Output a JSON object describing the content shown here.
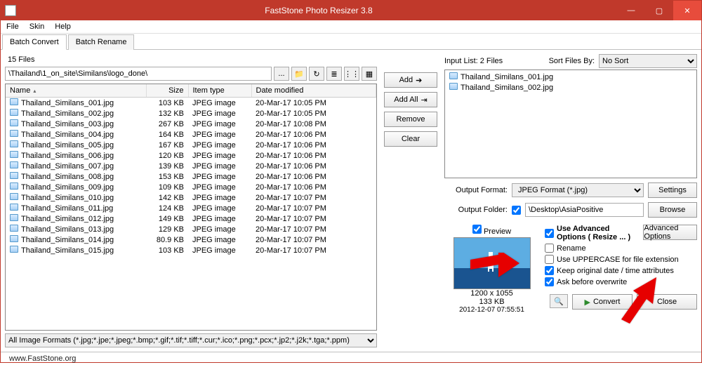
{
  "window": {
    "title": "FastStone Photo Resizer 3.8"
  },
  "menu": {
    "file": "File",
    "skin": "Skin",
    "help": "Help"
  },
  "tabs": {
    "convert": "Batch Convert",
    "rename": "Batch Rename"
  },
  "filecount": "15 Files",
  "path": "\\Thailand\\1_on_site\\Similans\\logo_done\\",
  "columns": {
    "name": "Name",
    "size": "Size",
    "type": "Item type",
    "modified": "Date modified"
  },
  "files": [
    {
      "name": "Thailand_Similans_001.jpg",
      "size": "103 KB",
      "type": "JPEG image",
      "mod": "20-Mar-17 10:05 PM"
    },
    {
      "name": "Thailand_Similans_002.jpg",
      "size": "132 KB",
      "type": "JPEG image",
      "mod": "20-Mar-17 10:05 PM"
    },
    {
      "name": "Thailand_Similans_003.jpg",
      "size": "267 KB",
      "type": "JPEG image",
      "mod": "20-Mar-17 10:08 PM"
    },
    {
      "name": "Thailand_Similans_004.jpg",
      "size": "164 KB",
      "type": "JPEG image",
      "mod": "20-Mar-17 10:06 PM"
    },
    {
      "name": "Thailand_Similans_005.jpg",
      "size": "167 KB",
      "type": "JPEG image",
      "mod": "20-Mar-17 10:06 PM"
    },
    {
      "name": "Thailand_Similans_006.jpg",
      "size": "120 KB",
      "type": "JPEG image",
      "mod": "20-Mar-17 10:06 PM"
    },
    {
      "name": "Thailand_Similans_007.jpg",
      "size": "139 KB",
      "type": "JPEG image",
      "mod": "20-Mar-17 10:06 PM"
    },
    {
      "name": "Thailand_Similans_008.jpg",
      "size": "153 KB",
      "type": "JPEG image",
      "mod": "20-Mar-17 10:06 PM"
    },
    {
      "name": "Thailand_Similans_009.jpg",
      "size": "109 KB",
      "type": "JPEG image",
      "mod": "20-Mar-17 10:06 PM"
    },
    {
      "name": "Thailand_Similans_010.jpg",
      "size": "142 KB",
      "type": "JPEG image",
      "mod": "20-Mar-17 10:07 PM"
    },
    {
      "name": "Thailand_Similans_011.jpg",
      "size": "124 KB",
      "type": "JPEG image",
      "mod": "20-Mar-17 10:07 PM"
    },
    {
      "name": "Thailand_Similans_012.jpg",
      "size": "149 KB",
      "type": "JPEG image",
      "mod": "20-Mar-17 10:07 PM"
    },
    {
      "name": "Thailand_Similans_013.jpg",
      "size": "129 KB",
      "type": "JPEG image",
      "mod": "20-Mar-17 10:07 PM"
    },
    {
      "name": "Thailand_Similans_014.jpg",
      "size": "80.9 KB",
      "type": "JPEG image",
      "mod": "20-Mar-17 10:07 PM"
    },
    {
      "name": "Thailand_Similans_015.jpg",
      "size": "103 KB",
      "type": "JPEG image",
      "mod": "20-Mar-17 10:07 PM"
    }
  ],
  "filter": "All Image Formats (*.jpg;*.jpe;*.jpeg;*.bmp;*.gif;*.tif;*.tiff;*.cur;*.ico;*.png;*.pcx;*.jp2;*.j2k;*.tga;*.ppm)",
  "buttons": {
    "add": "Add",
    "addall": "Add All",
    "remove": "Remove",
    "clear": "Clear",
    "settings": "Settings",
    "browse": "Browse",
    "advanced": "Advanced Options",
    "convert": "Convert",
    "close": "Close",
    "browseDots": "..."
  },
  "inputlist_label": "Input List:  2 Files",
  "sort_label": "Sort Files By:",
  "sort_value": "No Sort",
  "inputlist": [
    {
      "name": "Thailand_Similans_001.jpg"
    },
    {
      "name": "Thailand_Similans_002.jpg"
    }
  ],
  "output": {
    "format_label": "Output Format:",
    "format_value": "JPEG Format (*.jpg)",
    "folder_label": "Output Folder:",
    "folder_value": "\\Desktop\\AsiaPositive",
    "folder_checked": true
  },
  "preview": {
    "label": "Preview",
    "checked": true,
    "dims": "1200 x 1055",
    "size": "133 KB",
    "date": "2012-12-07 07:55:51"
  },
  "options": {
    "advanced": {
      "label": "Use Advanced Options ( Resize ... )",
      "checked": true
    },
    "rename": {
      "label": "Rename",
      "checked": false
    },
    "upper": {
      "label": "Use UPPERCASE for file extension",
      "checked": false
    },
    "keepdate": {
      "label": "Keep original date / time attributes",
      "checked": true
    },
    "ask": {
      "label": "Ask before overwrite",
      "checked": true
    }
  },
  "status": "www.FastStone.org"
}
